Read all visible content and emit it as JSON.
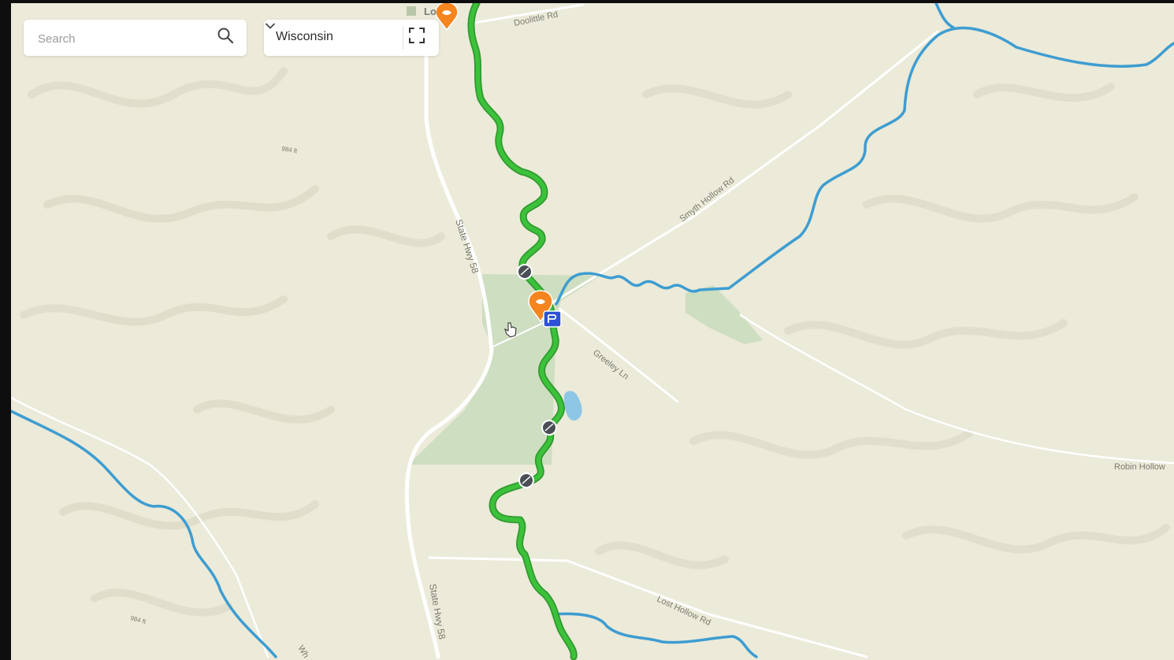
{
  "search": {
    "placeholder": "Search"
  },
  "region_selector": {
    "selected": "Wisconsin"
  },
  "controls": {
    "search_icon": "search-icon",
    "dropdown_icon": "chevron-down-icon",
    "fullscreen_icon": "fullscreen-icon"
  },
  "map": {
    "labels": {
      "doolittle_rd": "Doolittle Rd",
      "state_hwy_58_north": "State Hwy 58",
      "state_hwy_58_south": "State Hwy 58",
      "smyth_hollow_rd": "Smyth Hollow Rd",
      "greeley_ln": "Greeley Ln",
      "robin_hollow": "Robin Hollow",
      "lost_hollow_rd": "Lost Hollow Rd",
      "elev_1": "984 ft",
      "elev_2": "984 ft",
      "place_partial": "Lo",
      "road_partial": "Wh"
    },
    "colors": {
      "background": "#ecead9",
      "route": "#3cc13b",
      "stream": "#3d9dd1",
      "public_land": "#c9dcbc",
      "marker_orange": "#f5851f",
      "marker_blue": "#2d52d8"
    }
  }
}
